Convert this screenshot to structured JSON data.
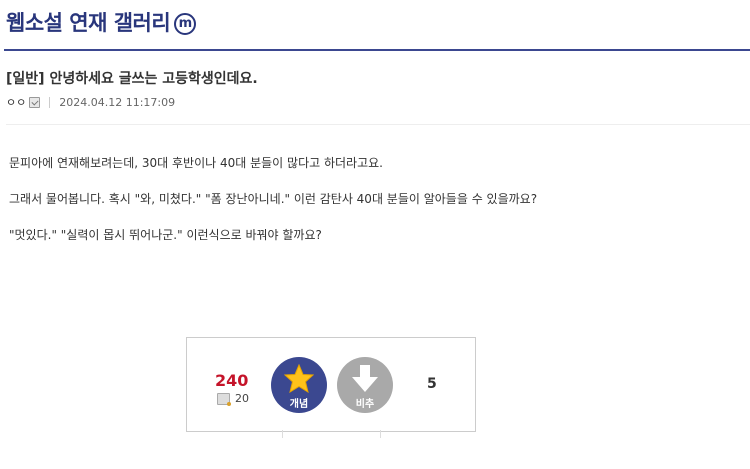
{
  "gallery": {
    "title": "웹소설 연재 갤러리",
    "badge": "m"
  },
  "post": {
    "head": "[일반]",
    "title": "안녕하세요 글쓰는 고등학생인데요.",
    "writer": "ㅇㅇ",
    "date": "2024.04.12 11:17:09",
    "paragraphs": [
      "문피아에 연재해보려는데, 30대 후반이나 40대 분들이 많다고 하더라고요.",
      "그래서 물어봅니다. 혹시 \"와, 미쳤다.\" \"폼 장난아니네.\" 이런 감탄사 40대 분들이 알아들을 수 있을까요?",
      "\"멋있다.\" \"실력이 몹시 뛰어나군.\" 이런식으로 바꿔야 할까요?"
    ]
  },
  "recommend": {
    "up_count": "240",
    "fixed_count": "20",
    "up_label": "개념",
    "down_label": "비추",
    "down_count": "5"
  },
  "colors": {
    "accent": "#3b4890",
    "title": "#29367c",
    "up_count": "#c5142a",
    "down_button": "#a9a9a9",
    "star": "#ffc21a"
  },
  "icons": {
    "up": "star-icon",
    "down": "down-arrow-icon",
    "writer": "fixed-nick-icon"
  }
}
